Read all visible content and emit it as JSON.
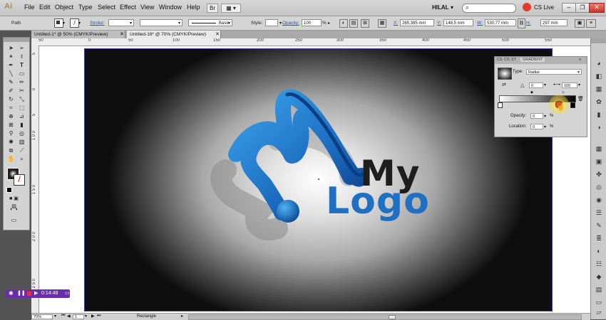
{
  "app": {
    "logo": "Ai",
    "icon": "illustrator-logo-icon"
  },
  "menu": [
    "File",
    "Edit",
    "Object",
    "Type",
    "Select",
    "Effect",
    "View",
    "Window",
    "Help"
  ],
  "titlebar_right": {
    "user": "HILAL",
    "cs_live": "CS Live",
    "search_placeholder": ""
  },
  "control": {
    "object_type": "Path",
    "stroke_label": "Stroke:",
    "brush_label": "Basic",
    "style_label": "Style:",
    "opacity_label": "Opacity:",
    "opacity_value": "100",
    "percent": "%",
    "x_label": "X:",
    "x_value": "265.385 mm",
    "y_label": "Y:",
    "y_value": "148.5 mm",
    "w_label": "W:",
    "w_value": "530.77 mm",
    "h_label": "H:",
    "h_value": "297 mm"
  },
  "tabs": [
    {
      "label": "Untitled-1* @ 50% (CMYK/Preview)",
      "active": false
    },
    {
      "label": "Untitled-16* @ 70% (CMYK/Preview)",
      "active": true
    }
  ],
  "ruler_h": [
    "50",
    "0",
    "50",
    "100",
    "150",
    "200",
    "250",
    "300",
    "350",
    "400",
    "450",
    "500",
    "550"
  ],
  "ruler_v": [
    "5",
    "0",
    "5",
    "1 0 0",
    "1 5 0",
    "2 0 0",
    "2 5 0"
  ],
  "artwork": {
    "text_line1": "My",
    "text_line2": "Logo",
    "colors": {
      "blue": "#1f6fc2",
      "dark": "#1e1e1e"
    }
  },
  "gradient_panel": {
    "tabs": [
      "CS",
      "CS",
      "ST",
      "GRADIENT"
    ],
    "type_label": "Type:",
    "type_value": "Radial",
    "angle_value": "0",
    "aspect_value": "100",
    "opacity_label": "Opacity:",
    "opacity_value": "0",
    "location_label": "Location:",
    "location_value": "0",
    "percent": "%"
  },
  "recorder": {
    "time": "0:14:48"
  },
  "status": {
    "zoom": "70%",
    "page": "1",
    "tool": "Rectangle"
  }
}
